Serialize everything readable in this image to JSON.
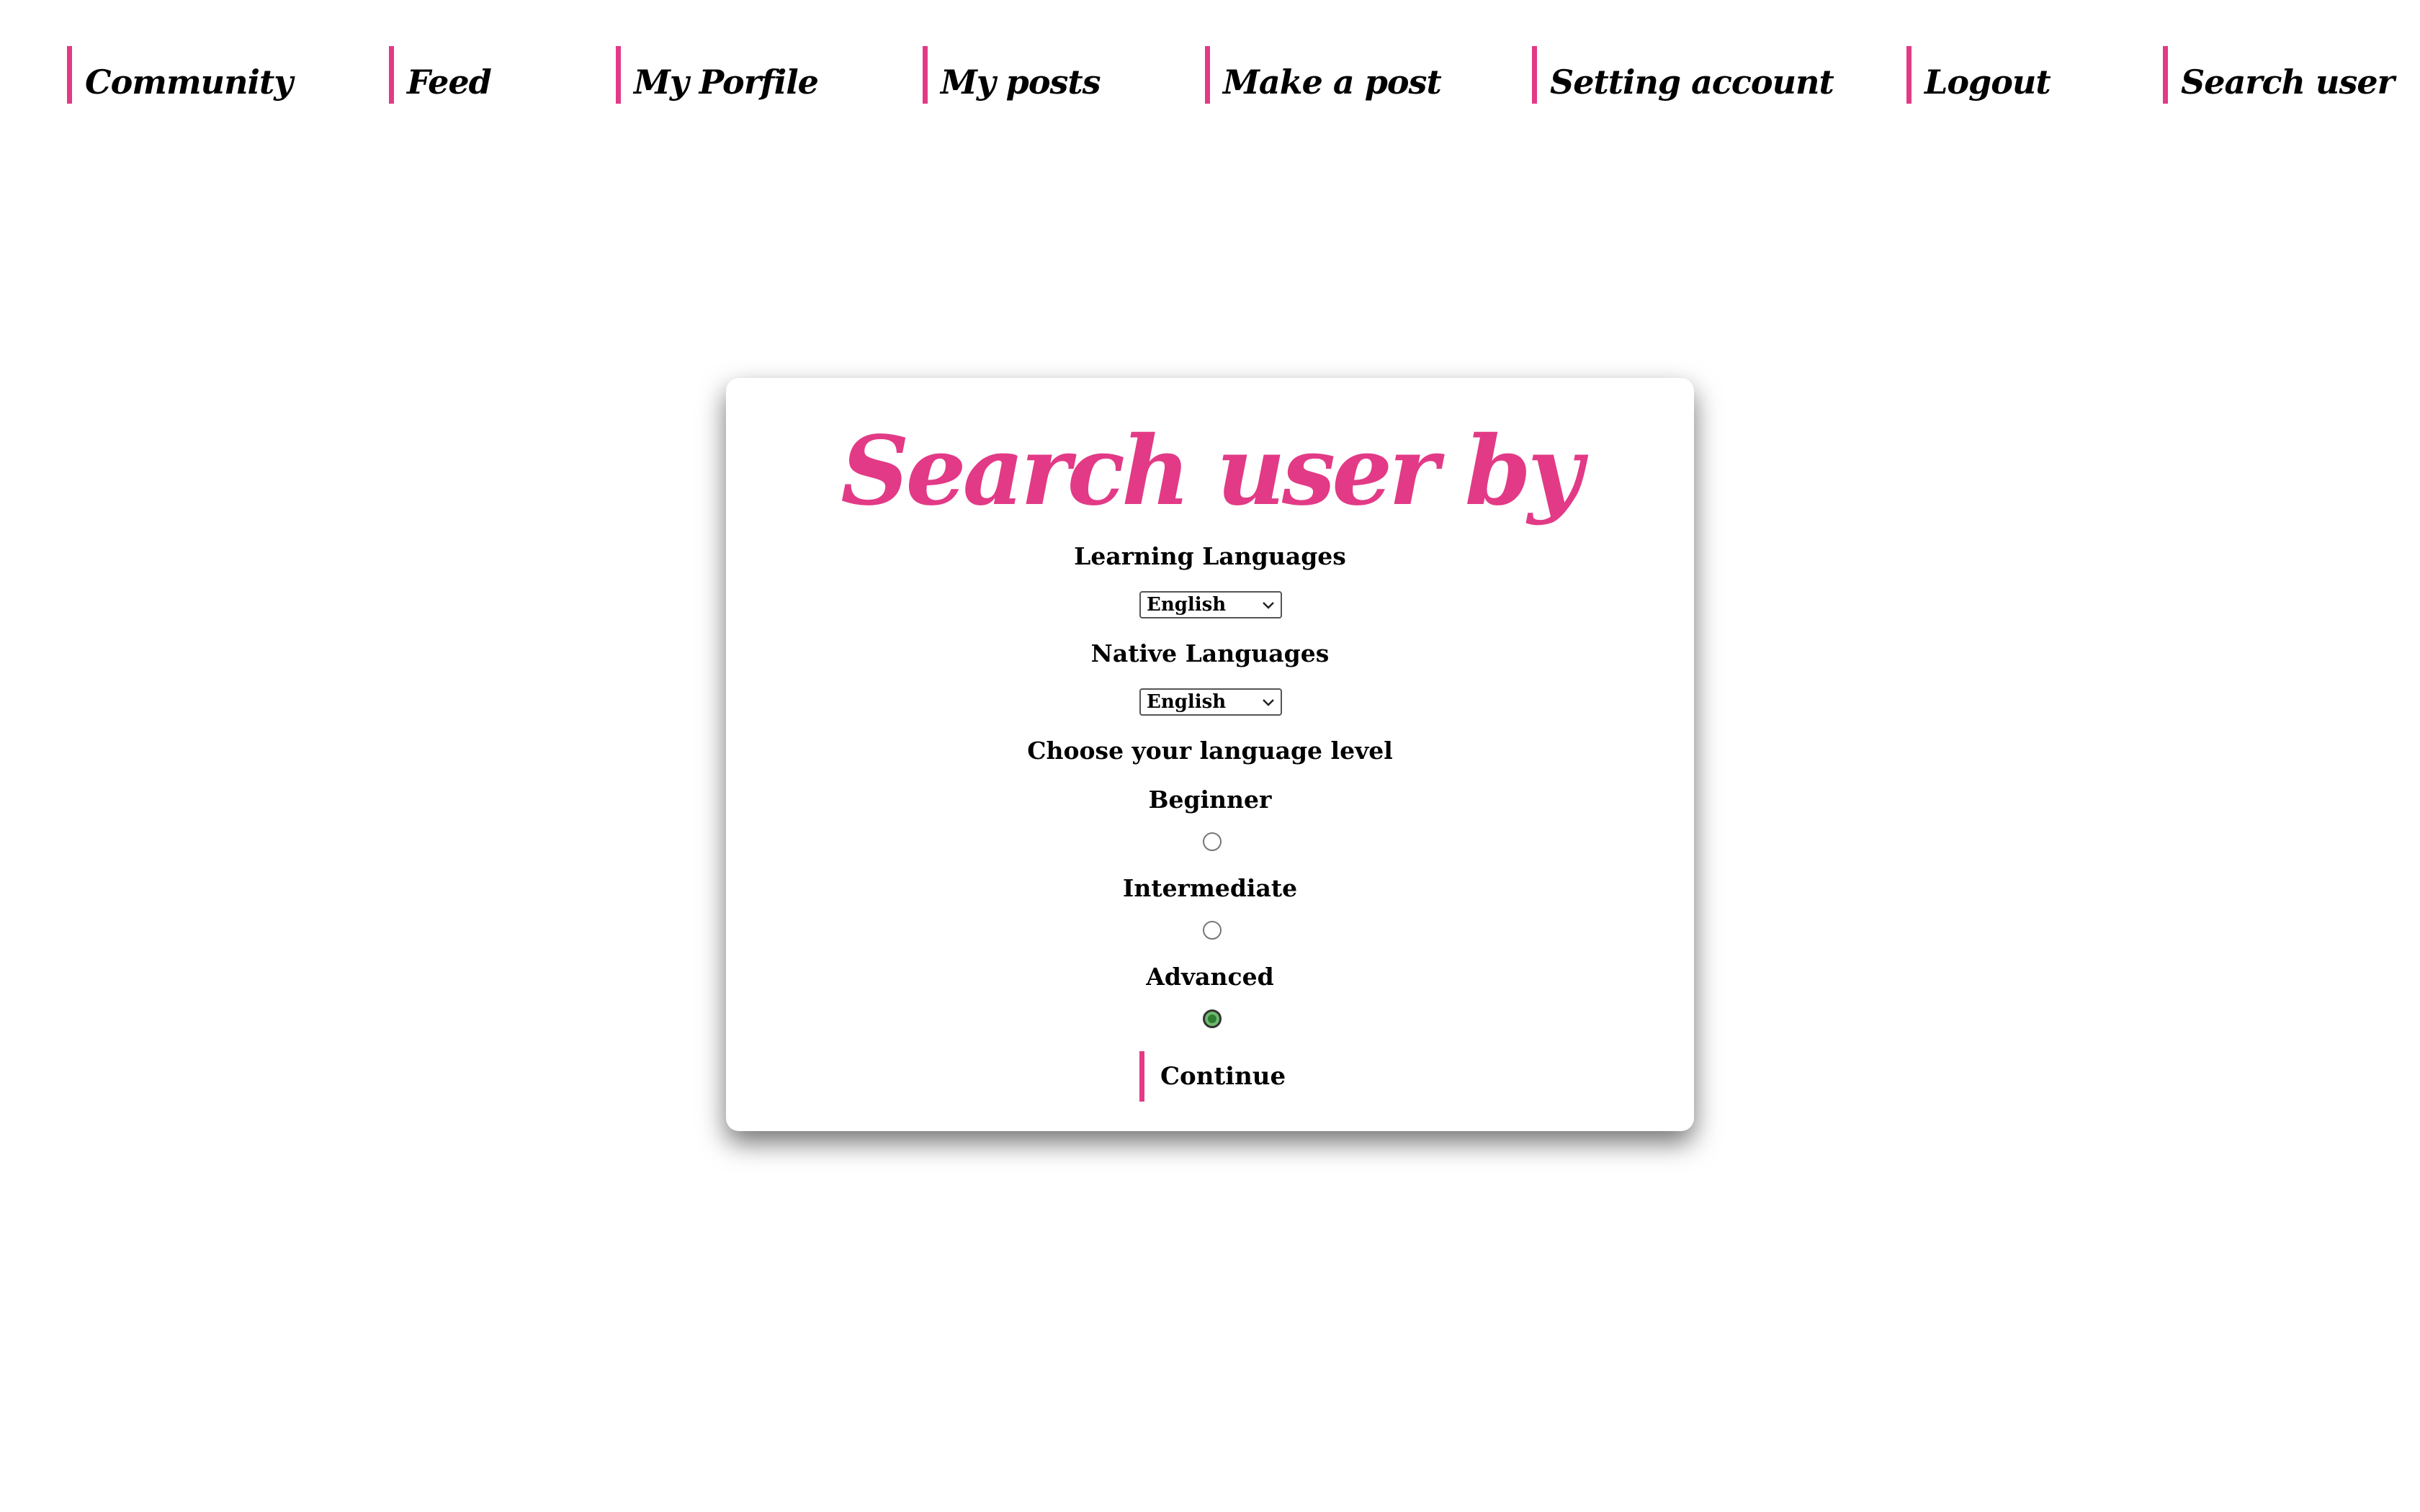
{
  "nav": {
    "items": [
      {
        "label": "Community"
      },
      {
        "label": "Feed"
      },
      {
        "label": "My Porfile"
      },
      {
        "label": "My posts"
      },
      {
        "label": "Make a post"
      },
      {
        "label": "Setting account"
      },
      {
        "label": "Logout"
      },
      {
        "label": "Search user"
      }
    ]
  },
  "search_form": {
    "title": "Search user by",
    "learning_label": "Learning Languages",
    "learning_value": "English",
    "native_label": "Native Languages",
    "native_value": "English",
    "level_label": "Choose your language level",
    "levels": [
      {
        "label": "Beginner",
        "checked": false
      },
      {
        "label": "Intermediate",
        "checked": false
      },
      {
        "label": "Advanced",
        "checked": true
      }
    ],
    "continue_label": "Continue"
  },
  "colors": {
    "accent": "#e23a86",
    "radio_checked": "#2f7d32"
  }
}
